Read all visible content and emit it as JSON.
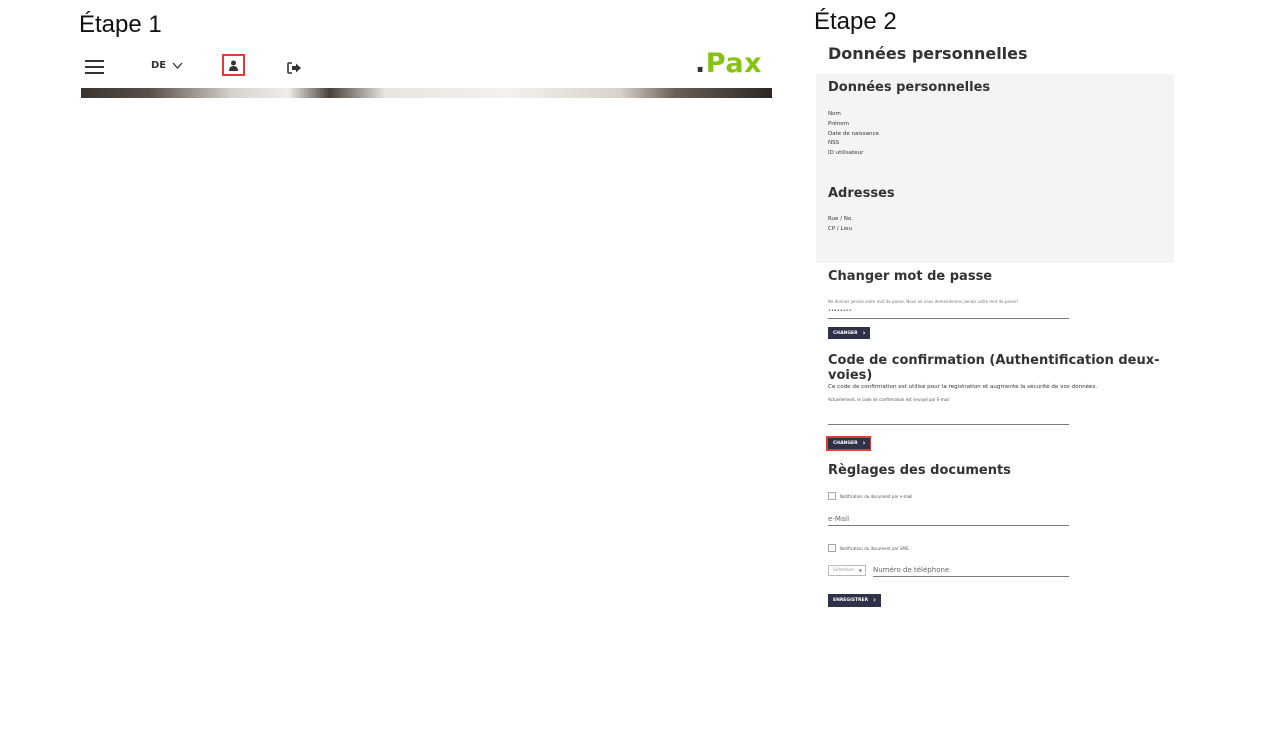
{
  "step1": {
    "title": "Étape 1",
    "nav": {
      "language": "DE",
      "logo_dot": ".",
      "logo_text": "Pax"
    }
  },
  "step2": {
    "title": "Étape 2",
    "heading": "Données personnelles",
    "personal_data": {
      "heading": "Données personnelles",
      "fields": [
        "Nom",
        "Prénom",
        "Date de naissance",
        "NSS",
        "ID utilisateur"
      ]
    },
    "addresses": {
      "heading": "Adresses",
      "fields": [
        "Rue / No.",
        "CP / Lieu"
      ]
    },
    "password": {
      "heading": "Changer mot de passe",
      "hint": "Ne donnez jamais votre mot de passe. Nous ne vous demanderons jamais votre mot de passe!",
      "masked_value": "••••••••",
      "button_label": "CHANGER"
    },
    "confirmation": {
      "heading": "Code de confirmation (Authentification deux-voies)",
      "description": "Ce code de confirmation est utilisé pour la registration et augmente la sécurité de vos données.",
      "current": "Actuellement, le code de confirmation est envoyé par E-mail",
      "button_label": "CHANGER"
    },
    "documents": {
      "heading": "Règlages des documents",
      "email_notification_label": "Notification du document par e-mail",
      "email_placeholder": "e-Mail",
      "sms_notification_label": "Notification du document par SMS",
      "country_select": "Sélection",
      "phone_placeholder": "Numéro de téléphone",
      "save_button_label": "ENREGISTRER"
    }
  },
  "colors": {
    "logo_green": "#86c30f",
    "highlight_red": "#e03a3a",
    "button_dark": "#2f3147",
    "panel_grey": "#f4f4f4"
  }
}
